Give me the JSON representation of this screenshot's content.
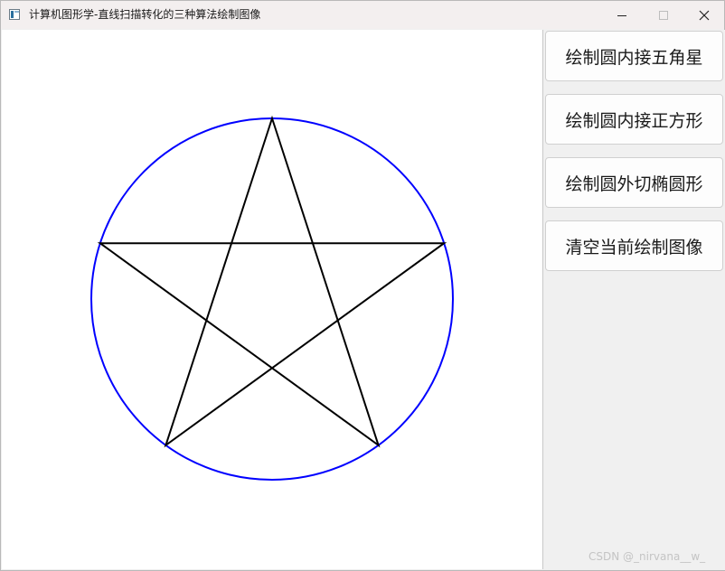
{
  "window": {
    "title": "计算机图形学-直线扫描转化的三种算法绘制图像",
    "icons": {
      "app": "app-window-icon",
      "minimize": "minimize-icon",
      "maximize": "maximize-icon",
      "close": "close-icon"
    }
  },
  "canvas": {
    "circle_color": "#0000ff",
    "star_color": "#000000",
    "background": "#ffffff"
  },
  "side_panel": {
    "buttons": [
      {
        "label": "绘制圆内接五角星"
      },
      {
        "label": "绘制圆内接正方形"
      },
      {
        "label": "绘制圆外切椭圆形"
      },
      {
        "label": "清空当前绘制图像"
      }
    ]
  },
  "watermark": "CSDN @_nirvana__w_"
}
